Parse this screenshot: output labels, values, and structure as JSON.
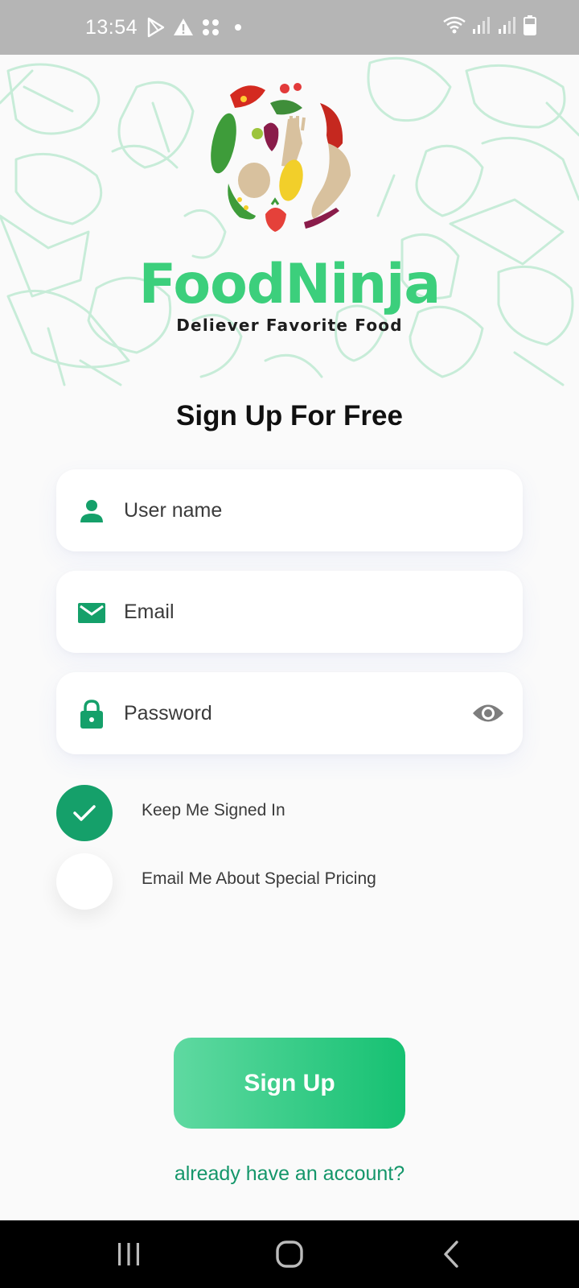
{
  "status_bar": {
    "time": "13:54",
    "icons_left": [
      "play-store-icon",
      "warning-icon",
      "grid-dots-icon",
      "dot-icon"
    ],
    "icons_right": [
      "wifi-icon",
      "signal-icon",
      "signal-icon-2",
      "battery-icon"
    ]
  },
  "hero": {
    "brand_name": "FoodNinja",
    "tagline": "Deliever Favorite Food"
  },
  "page_title": "Sign Up For Free",
  "form": {
    "username": {
      "placeholder": "User name",
      "value": "",
      "icon": "user-icon"
    },
    "email": {
      "placeholder": "Email",
      "value": "",
      "icon": "mail-icon"
    },
    "password": {
      "placeholder": "Password",
      "value": "",
      "icon": "lock-icon",
      "toggle_icon": "eye-icon"
    }
  },
  "options": [
    {
      "label": "Keep Me Signed In",
      "checked": true
    },
    {
      "label": "Email Me About Special Pricing",
      "checked": false
    }
  ],
  "signup_button": "Sign Up",
  "login_link": "already have an account?",
  "colors": {
    "brand_green": "#3ccf7c",
    "accent_green": "#15a06a",
    "button_gradient_start": "#5fd9a1",
    "button_gradient_end": "#16c172"
  },
  "nav_bar": [
    "recent-apps-icon",
    "home-icon",
    "back-icon"
  ]
}
